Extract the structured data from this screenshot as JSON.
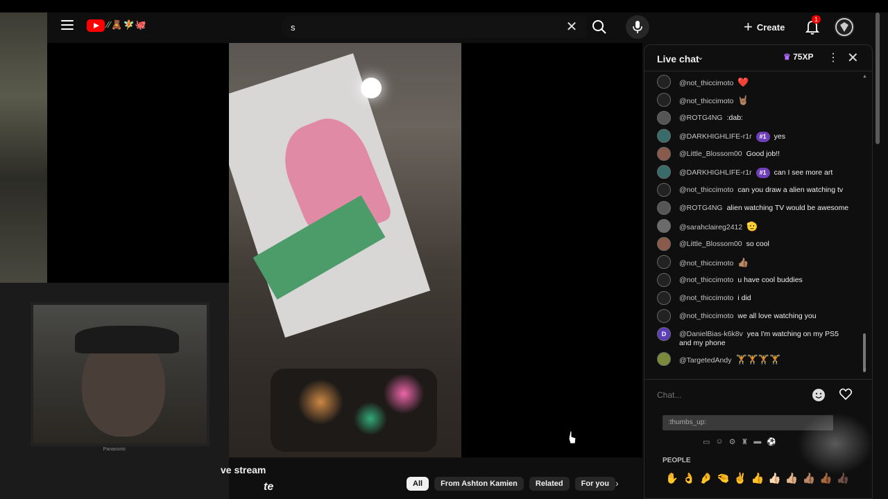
{
  "header": {
    "channel_glyphs": "⁄⁄🧸🧚🐙",
    "search": {
      "value": "s"
    },
    "create_label": "Create",
    "notification_count": "1"
  },
  "below_video": {
    "title_fragment": "ve stream",
    "subtitle_fragment": "te",
    "chips": [
      {
        "label": "All",
        "active": true
      },
      {
        "label": "From Ashton Kamien",
        "active": false
      },
      {
        "label": "Related",
        "active": false
      },
      {
        "label": "For you",
        "active": false
      }
    ]
  },
  "webcam": {
    "brand": "Panasonic"
  },
  "chat": {
    "title": "Live chat",
    "xp_label": "75XP",
    "input_placeholder": "Chat...",
    "emoji_search_value": ":thumbs_up:",
    "people_label": "PEOPLE",
    "messages": [
      {
        "author": "@not_thiccimoto",
        "text": "",
        "emoji": "❤️",
        "avatar_color": "#222",
        "avatar_letter": ""
      },
      {
        "author": "@not_thiccimoto",
        "text": "",
        "emoji": "🤘🏽",
        "avatar_color": "#222",
        "avatar_letter": ""
      },
      {
        "author": "@ROTG4NG",
        "text": ":dab:",
        "emoji": "",
        "avatar_color": "#555",
        "avatar_letter": ""
      },
      {
        "author": "@DARKHIGHLIFE-r1r",
        "badge": "#1",
        "text": "yes",
        "emoji": "",
        "avatar_color": "#3a6b6b",
        "avatar_letter": ""
      },
      {
        "author": "@Little_Blossom00",
        "text": "Good job!!",
        "emoji": "",
        "avatar_color": "#8a5a4a",
        "avatar_letter": ""
      },
      {
        "author": "@DARKHIGHLIFE-r1r",
        "badge": "#1",
        "text": "can I see more art",
        "emoji": "",
        "avatar_color": "#3a6b6b",
        "avatar_letter": ""
      },
      {
        "author": "@not_thiccimoto",
        "text": "can you draw a alien watching tv",
        "emoji": "",
        "avatar_color": "#222",
        "avatar_letter": ""
      },
      {
        "author": "@ROTG4NG",
        "text": "alien watching TV would be awesome",
        "emoji": "",
        "avatar_color": "#555",
        "avatar_letter": ""
      },
      {
        "author": "@sarahclaireg2412",
        "text": "",
        "emoji": "🫡",
        "avatar_color": "#6b6b6b",
        "avatar_letter": ""
      },
      {
        "author": "@Little_Blossom00",
        "text": "so cool",
        "emoji": "",
        "avatar_color": "#8a5a4a",
        "avatar_letter": ""
      },
      {
        "author": "@not_thiccimoto",
        "text": "",
        "emoji": "👍🏽",
        "avatar_color": "#222",
        "avatar_letter": ""
      },
      {
        "author": "@not_thiccimoto",
        "text": "u have cool buddies",
        "emoji": "",
        "avatar_color": "#222",
        "avatar_letter": ""
      },
      {
        "author": "@not_thiccimoto",
        "text": "i did",
        "emoji": "",
        "avatar_color": "#222",
        "avatar_letter": ""
      },
      {
        "author": "@not_thiccimoto",
        "text": "we all love watching you",
        "emoji": "",
        "avatar_color": "#222",
        "avatar_letter": ""
      },
      {
        "author": "@DanielBias-k6k8v",
        "text": "yea I'm watching on my PS5 and my phone",
        "emoji": "",
        "avatar_color": "#5c3fb8",
        "avatar_letter": "D"
      },
      {
        "author": "@TargetedAndy",
        "text": "",
        "emoji": "🏋️🏋️🏋️🏋️",
        "avatar_color": "#7a8a3a",
        "avatar_letter": ""
      }
    ],
    "emoji_categories": [
      "▭",
      "☺",
      "⚙",
      "♜",
      "▬",
      "⚽"
    ],
    "emoji_row": [
      "✋",
      "👌",
      "🤌",
      "🤏",
      "✌️",
      "👍",
      "👍🏻",
      "👍🏼",
      "👍🏽",
      "👍🏾",
      "👍🏿"
    ]
  },
  "colors": {
    "accent_red": "#ff0000",
    "badge_purple": "#6e3fb8",
    "background": "#0f0f0f"
  }
}
